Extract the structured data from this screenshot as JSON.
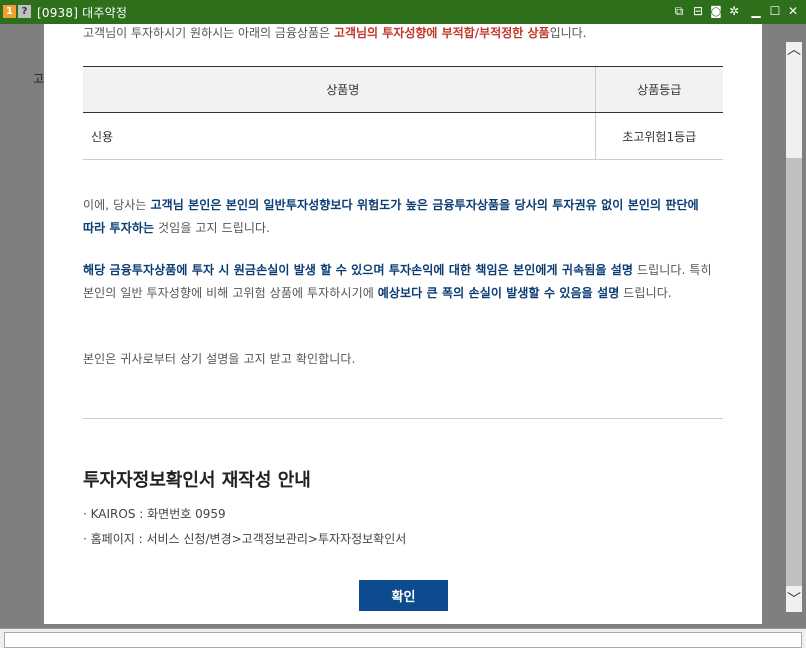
{
  "window": {
    "title": "[0938] 대주약정",
    "badge_one": "1",
    "badge_q": "?",
    "icons": [
      "link-icon",
      "split-icon",
      "camera-icon",
      "gear-icon",
      "minimize-icon",
      "maximize-icon",
      "close-icon"
    ]
  },
  "background": {
    "fragment": "고"
  },
  "modal": {
    "intro": {
      "text": "고객님이 투자하시기 원하시는 아래의 금융상품은 ",
      "emphasis": "고객님의 투자성향에 부적합/부적정한 상품",
      "suffix": "입니다."
    },
    "table": {
      "headers": [
        "상품명",
        "상품등급"
      ],
      "rows": [
        {
          "name": "신용",
          "grade": "초고위험1등급"
        }
      ]
    },
    "para1": {
      "t1": "이에, 당사는 ",
      "b1": "고객님 본인은 본인의 일반투자성향보다 위험도가 높은 금융투자상품을 당사의 투자권유 없이 본인의 판단에 따라 투자하는",
      "t2": " 것임을 고지 드립니다."
    },
    "para2": {
      "b1": "해당 금융투자상품에 투자 시 원금손실이 발생 할 수 있으며 투자손익에 대한 책임은 본인에게 귀속됨을 설명",
      "t1": " 드립니다. 특히 본인의 일반 투자성향에 비해 고위험 상품에 투자하시기에 ",
      "b2": "예상보다 큰 폭의 손실이 발생할 수 있음을 설명",
      "t2": " 드립니다."
    },
    "para3": "본인은 귀사로부터 상기 설명을 고지 받고 확인합니다.",
    "guide": {
      "title": "투자자정보확인서 재작성 안내",
      "line1": "· KAIROS : 화면번호 0959",
      "line2": "· 홈페이지 : 서비스 신청/변경>고객정보관리>투자자정보확인서"
    },
    "confirm_label": "확인"
  },
  "colors": {
    "titlebar": "#2e6f1b",
    "accent_blue": "#0c4b8e",
    "emphasis_red": "#c0392b"
  }
}
